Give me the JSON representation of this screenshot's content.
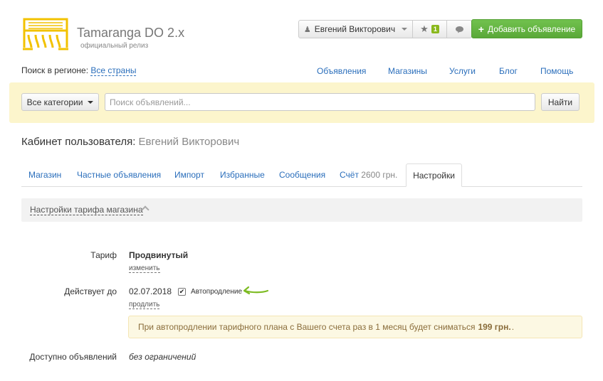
{
  "brand": {
    "title": "Tamaranga DO 2.x",
    "subtitle": "официальный релиз",
    "logo_color": "#f2c200"
  },
  "header": {
    "user_name": "Евгений Викторович",
    "favorites_count": "1",
    "add_button": "Добавить объявление",
    "accent_color": "#5cb336"
  },
  "region": {
    "label": "Поиск в регионе:",
    "value": "Все страны"
  },
  "topnav": [
    "Объявления",
    "Магазины",
    "Услуги",
    "Блог",
    "Помощь"
  ],
  "search": {
    "category": "Все категории",
    "placeholder": "Поиск объявлений...",
    "button": "Найти"
  },
  "cabinet": {
    "title": "Кабинет пользователя:",
    "user": "Евгений Викторович"
  },
  "tabs": {
    "shop": "Магазин",
    "private": "Частные объявления",
    "import": "Импорт",
    "favorites": "Избранные",
    "messages": "Сообщения",
    "account_label": "Счёт",
    "account_value": "2600 грн.",
    "settings": "Настройки"
  },
  "panel": {
    "title": "Настройки тарифа магазина"
  },
  "tariff": {
    "label": "Тариф",
    "value": "Продвинутый",
    "change_link": "изменить"
  },
  "valid": {
    "label": "Действует до",
    "date": "02.07.2018",
    "auto_renew_label": "Автопродление",
    "auto_renew_checked": true,
    "extend_link": "продлить"
  },
  "notice": {
    "text": "При автопродлении тарифного плана с Вашего счета раз в 1 месяц будет сниматься",
    "amount": "199 грн.",
    "suffix": "."
  },
  "available": {
    "label": "Доступно объявлений",
    "value": "без ограничений"
  }
}
